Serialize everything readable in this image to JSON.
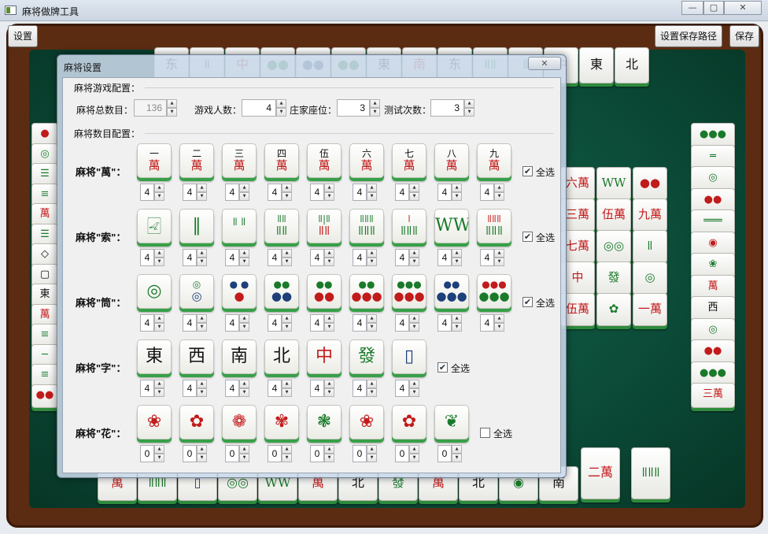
{
  "app": {
    "title": "麻将做牌工具",
    "win_min": "—",
    "win_max": "▢",
    "win_close": "✕"
  },
  "toolbar": {
    "settings": "设置",
    "set_path": "设置保存路径",
    "save": "保存"
  },
  "dialog": {
    "title": "麻将设置",
    "close": "✕",
    "game_section": "麻将游戏配置：",
    "total_label": "麻将总数目：",
    "total_value": "136",
    "players_label": "游戏人数：",
    "players_value": "4",
    "dealer_label": "庄家座位：",
    "dealer_value": "3",
    "tests_label": "测试次数：",
    "tests_value": "3",
    "count_section": "麻将数目配置：",
    "select_all": "全选",
    "rows": [
      {
        "label": "麻将\"萬\"：",
        "checked": true,
        "tiles": [
          {
            "top": "一",
            "bot": "萬",
            "tc": "blk",
            "bc": "red"
          },
          {
            "top": "二",
            "bot": "萬",
            "tc": "blk",
            "bc": "red"
          },
          {
            "top": "三",
            "bot": "萬",
            "tc": "blk",
            "bc": "red"
          },
          {
            "top": "四",
            "bot": "萬",
            "tc": "blk",
            "bc": "red"
          },
          {
            "top": "伍",
            "bot": "萬",
            "tc": "blk",
            "bc": "red"
          },
          {
            "top": "六",
            "bot": "萬",
            "tc": "blk",
            "bc": "red"
          },
          {
            "top": "七",
            "bot": "萬",
            "tc": "blk",
            "bc": "red"
          },
          {
            "top": "八",
            "bot": "萬",
            "tc": "blk",
            "bc": "red"
          },
          {
            "top": "九",
            "bot": "萬",
            "tc": "blk",
            "bc": "red"
          }
        ],
        "counts": [
          "4",
          "4",
          "4",
          "4",
          "4",
          "4",
          "4",
          "4",
          "4"
        ]
      },
      {
        "label": "麻将\"索\"：",
        "checked": true,
        "tiles": [
          {
            "top": "🀐",
            "bot": "",
            "tc": "grn",
            "bc": "grn"
          },
          {
            "top": "‖",
            "bot": "",
            "tc": "grn",
            "bc": "grn"
          },
          {
            "top": "ǁ ǁ",
            "bot": "",
            "tc": "grn",
            "bc": "grn"
          },
          {
            "top": "ǁǁ",
            "bot": "ǁǁ",
            "tc": "grn",
            "bc": "grn"
          },
          {
            "top": "ǁ|ǁ",
            "bot": "ǁǁ",
            "tc": "grn",
            "bc": "red"
          },
          {
            "top": "ǁǁǁ",
            "bot": "ǁǁǁ",
            "tc": "grn",
            "bc": "grn"
          },
          {
            "top": "ǀ",
            "bot": "ǁǁǁ",
            "tc": "red",
            "bc": "grn"
          },
          {
            "top": "WW",
            "bot": "",
            "tc": "grn",
            "bc": "grn"
          },
          {
            "top": "ǁǁǁ",
            "bot": "ǁǁǁ",
            "tc": "red",
            "bc": "grn"
          }
        ],
        "counts": [
          "4",
          "4",
          "4",
          "4",
          "4",
          "4",
          "4",
          "4",
          "4"
        ]
      },
      {
        "label": "麻将\"筒\"：",
        "checked": true,
        "tiles": [
          {
            "top": "◎",
            "bot": "",
            "tc": "grn",
            "bc": "grn"
          },
          {
            "top": "◎",
            "bot": "◎",
            "tc": "grn",
            "bc": "blu"
          },
          {
            "top": "● ●",
            "bot": "●",
            "tc": "blu",
            "bc": "red"
          },
          {
            "top": "●●",
            "bot": "●●",
            "tc": "grn",
            "bc": "blu"
          },
          {
            "top": "●●",
            "bot": "●●",
            "tc": "grn",
            "bc": "red"
          },
          {
            "top": "●●",
            "bot": "●●●",
            "tc": "grn",
            "bc": "red"
          },
          {
            "top": "●●●",
            "bot": "●●●",
            "tc": "grn",
            "bc": "red"
          },
          {
            "top": "●●",
            "bot": "●●●",
            "tc": "blu",
            "bc": "blu"
          },
          {
            "top": "●●●",
            "bot": "●●●",
            "tc": "red",
            "bc": "grn"
          }
        ],
        "counts": [
          "4",
          "4",
          "4",
          "4",
          "4",
          "4",
          "4",
          "4",
          "4"
        ]
      },
      {
        "label": "麻将\"字\"：",
        "checked": true,
        "tiles": [
          {
            "top": "東",
            "bot": "",
            "tc": "blk",
            "bc": "blk"
          },
          {
            "top": "西",
            "bot": "",
            "tc": "blk",
            "bc": "blk"
          },
          {
            "top": "南",
            "bot": "",
            "tc": "blk",
            "bc": "blk"
          },
          {
            "top": "北",
            "bot": "",
            "tc": "blk",
            "bc": "blk"
          },
          {
            "top": "中",
            "bot": "",
            "tc": "red",
            "bc": "red"
          },
          {
            "top": "發",
            "bot": "",
            "tc": "grn",
            "bc": "grn"
          },
          {
            "top": "▯",
            "bot": "",
            "tc": "blu",
            "bc": "blu"
          }
        ],
        "counts": [
          "4",
          "4",
          "4",
          "4",
          "4",
          "4",
          "4"
        ]
      },
      {
        "label": "麻将\"花\"：",
        "checked": false,
        "tiles": [
          {
            "top": "❀",
            "bot": "",
            "tc": "red",
            "bc": "red"
          },
          {
            "top": "✿",
            "bot": "",
            "tc": "red",
            "bc": "red"
          },
          {
            "top": "❁",
            "bot": "",
            "tc": "red",
            "bc": "red"
          },
          {
            "top": "✾",
            "bot": "",
            "tc": "red",
            "bc": "red"
          },
          {
            "top": "❃",
            "bot": "",
            "tc": "grn",
            "bc": "grn"
          },
          {
            "top": "❀",
            "bot": "",
            "tc": "red",
            "bc": "red"
          },
          {
            "top": "✿",
            "bot": "",
            "tc": "red",
            "bc": "red"
          },
          {
            "top": "❦",
            "bot": "",
            "tc": "grn",
            "bc": "grn"
          }
        ],
        "counts": [
          "0",
          "0",
          "0",
          "0",
          "0",
          "0",
          "0",
          "0"
        ]
      }
    ]
  },
  "board": {
    "colors": {
      "felt": "#0b4a37",
      "frame": "#5b2c12",
      "tile_edge": "#2e8b3c"
    },
    "top_row": [
      {
        "g": "东",
        "c": "blk"
      },
      {
        "g": "ǁ",
        "c": "grn"
      },
      {
        "g": "中",
        "c": "red"
      },
      {
        "g": "●●",
        "c": "grn"
      },
      {
        "g": "●●",
        "c": "blu"
      },
      {
        "g": "●●",
        "c": "grn"
      },
      {
        "g": "東",
        "c": "blk"
      },
      {
        "g": "南",
        "c": "red"
      },
      {
        "g": "东",
        "c": "blk"
      },
      {
        "g": "ǁǁ",
        "c": "grn"
      },
      {
        "g": "ǁ",
        "c": "grn"
      },
      {
        "g": "中",
        "c": "red"
      },
      {
        "g": "東",
        "c": "blk"
      },
      {
        "g": "北",
        "c": "blk"
      }
    ],
    "left_col": [
      {
        "g": "●",
        "c": "red"
      },
      {
        "g": "◎",
        "c": "grn"
      },
      {
        "g": "☰",
        "c": "grn"
      },
      {
        "g": "≡",
        "c": "grn"
      },
      {
        "g": "萬",
        "c": "red"
      },
      {
        "g": "☰",
        "c": "grn"
      },
      {
        "g": "◇",
        "c": "blk"
      },
      {
        "g": "▢",
        "c": "blk"
      },
      {
        "g": "東",
        "c": "blk"
      },
      {
        "g": "萬",
        "c": "red"
      },
      {
        "g": "≡",
        "c": "grn"
      },
      {
        "g": "─",
        "c": "grn"
      },
      {
        "g": "≡",
        "c": "grn"
      },
      {
        "g": "●●",
        "c": "red"
      }
    ],
    "right_col": [
      {
        "g": "●●●",
        "c": "grn"
      },
      {
        "g": "═",
        "c": "grn"
      },
      {
        "g": "◎",
        "c": "grn"
      },
      {
        "g": "●●",
        "c": "red"
      },
      {
        "g": "═══",
        "c": "grn"
      },
      {
        "g": "◉",
        "c": "red"
      },
      {
        "g": "❀",
        "c": "grn"
      },
      {
        "g": "萬",
        "c": "red"
      },
      {
        "g": "西",
        "c": "blk"
      },
      {
        "g": "◎",
        "c": "grn"
      },
      {
        "g": "●●",
        "c": "red"
      },
      {
        "g": "●●●",
        "c": "grn"
      },
      {
        "g": "三萬",
        "c": "red"
      }
    ],
    "mid_right": [
      {
        "g": "六萬",
        "c": "red"
      },
      {
        "g": "WW",
        "c": "grn"
      },
      {
        "g": "●●",
        "c": "red"
      },
      {
        "g": "三萬",
        "c": "red"
      },
      {
        "g": "伍萬",
        "c": "red"
      },
      {
        "g": "九萬",
        "c": "red"
      },
      {
        "g": "七萬",
        "c": "red"
      },
      {
        "g": "◎◎",
        "c": "grn"
      },
      {
        "g": "ǁ",
        "c": "grn"
      },
      {
        "g": "中",
        "c": "red"
      },
      {
        "g": "發",
        "c": "grn"
      },
      {
        "g": "◎",
        "c": "grn"
      },
      {
        "g": "伍萬",
        "c": "red"
      },
      {
        "g": "✿",
        "c": "grn"
      },
      {
        "g": "一萬",
        "c": "red"
      }
    ],
    "bottom_row": [
      {
        "g": "萬",
        "c": "red"
      },
      {
        "g": "ǁǁǁ",
        "c": "grn"
      },
      {
        "g": "▯",
        "c": "blu"
      },
      {
        "g": "◎◎",
        "c": "grn"
      },
      {
        "g": "WW",
        "c": "grn"
      },
      {
        "g": "萬",
        "c": "red"
      },
      {
        "g": "北",
        "c": "blk"
      },
      {
        "g": "發",
        "c": "grn"
      },
      {
        "g": "萬",
        "c": "red"
      },
      {
        "g": "北",
        "c": "blk"
      },
      {
        "g": "◉",
        "c": "grn"
      },
      {
        "g": "南",
        "c": "blk"
      },
      {
        "g": "二萬",
        "c": "red"
      },
      {
        "g": "ǁǁǁ",
        "c": "grn"
      }
    ]
  }
}
